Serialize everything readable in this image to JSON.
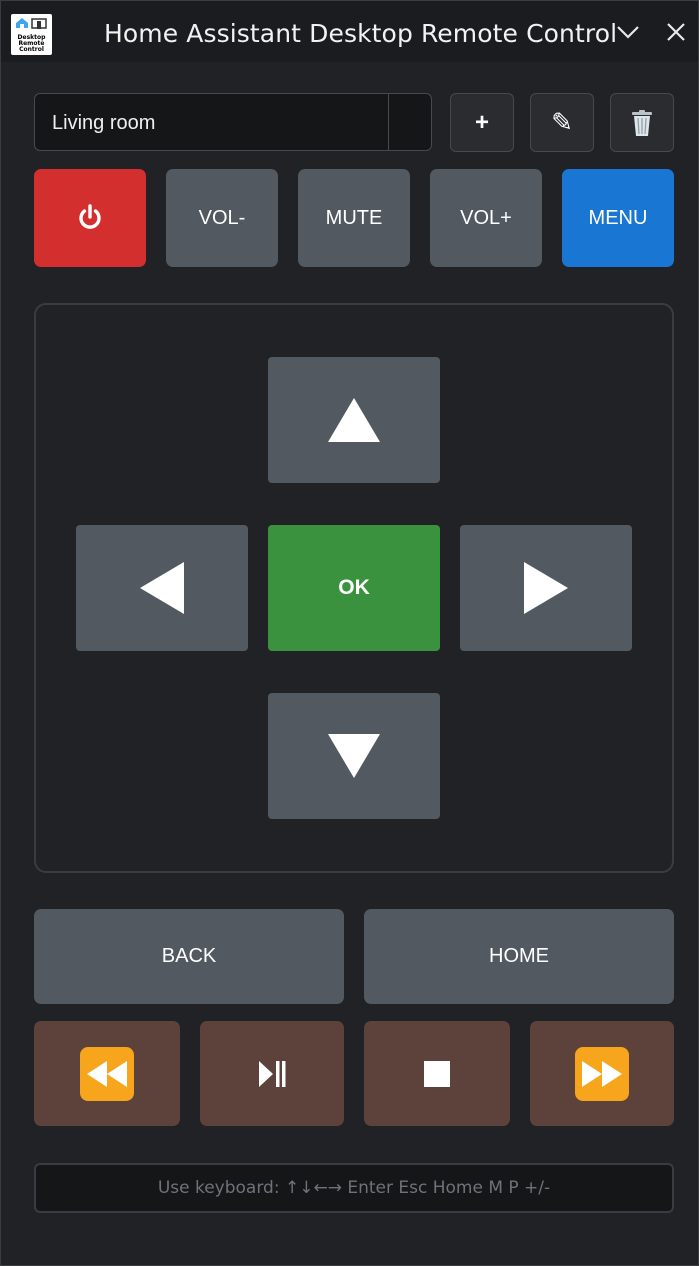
{
  "window": {
    "title": "Home Assistant Desktop Remote Control",
    "logo_text": [
      "Desktop",
      "Remote",
      "Control"
    ]
  },
  "device": {
    "selected": "Living room",
    "add_label": "+",
    "edit_label": "✎"
  },
  "controls": {
    "vol_down": "VOL-",
    "mute": "MUTE",
    "vol_up": "VOL+",
    "menu": "MENU"
  },
  "dpad": {
    "ok": "OK"
  },
  "nav": {
    "back": "BACK",
    "home": "HOME"
  },
  "hint": {
    "text": "Use keyboard: ↑↓←→ Enter Esc Home M P +/-"
  },
  "colors": {
    "power": "#d32f2f",
    "menu": "#1976d2",
    "ok": "#3a923e",
    "gray_button": "#535961",
    "media_button": "#5c423a",
    "background": "#202225"
  },
  "icons": {
    "power": "power-icon",
    "delete": "trash-icon",
    "rewind": "rewind-icon",
    "play_pause": "play-pause-icon",
    "stop": "stop-icon",
    "fast_forward": "fast-forward-icon"
  }
}
